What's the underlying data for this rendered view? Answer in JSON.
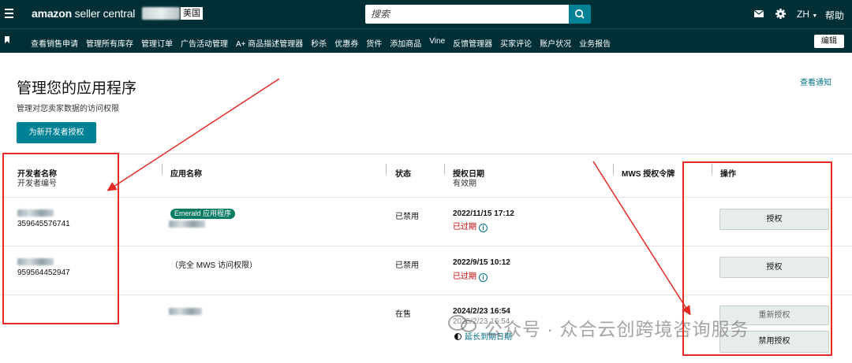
{
  "header": {
    "brand_bold": "amazon",
    "brand_light": " seller central",
    "store_label": "美国",
    "search_placeholder": "搜索",
    "language": "ZH",
    "help": "帮助"
  },
  "nav": {
    "items": [
      "查看销售申请",
      "管理所有库存",
      "管理订单",
      "广告活动管理",
      "A+ 商品描述管理器",
      "秒杀",
      "优惠券",
      "货件",
      "添加商品",
      "Vine",
      "反馈管理器",
      "买家评论",
      "账户状况",
      "业务报告"
    ],
    "edit_label": "编辑"
  },
  "page": {
    "title": "管理您的应用程序",
    "subtitle": "管理对您卖家数据的访问权限",
    "new_developer_button": "为新开发者授权",
    "view_notifications": "查看通知"
  },
  "table": {
    "headers": {
      "developer_name": "开发者名称",
      "developer_id": "开发者编号",
      "app_name": "应用名称",
      "status": "状态",
      "auth_date": "授权日期",
      "valid_until": "有效期",
      "mws_token": "MWS 授权令牌",
      "actions": "操作"
    },
    "rows": [
      {
        "developer_id": "359645576741",
        "app_badge": "Emerald 应用程序",
        "status": "已禁用",
        "auth_date": "2022/11/15 17:12",
        "validity": "已过期",
        "action": "授权"
      },
      {
        "developer_id": "959564452947",
        "app_name": "（完全 MWS 访问权限）",
        "status": "已禁用",
        "auth_date": "2022/9/15 10:12",
        "validity": "已过期",
        "action": "授权"
      },
      {
        "status": "在售",
        "auth_date": "2024/2/23 16:54",
        "validity": "2025/2/23 16:54",
        "extend_link": "延长到期日期",
        "action_primary": "重新授权",
        "action_secondary": "禁用授权"
      }
    ]
  },
  "watermark": {
    "text": "公众号 · 众合云创跨境咨询服务"
  },
  "colors": {
    "header_bg": "#002f36",
    "primary_button": "#008296",
    "link": "#007185",
    "expired": "#c40000",
    "badge": "#067d62",
    "annotation_red": "#e52a23"
  }
}
